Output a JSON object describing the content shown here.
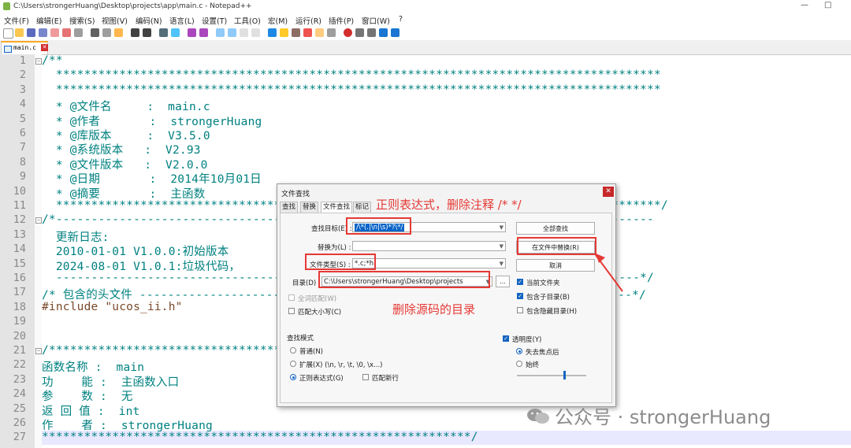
{
  "window": {
    "title": "C:\\Users\\strongerHuang\\Desktop\\projects\\app\\main.c - Notepad++",
    "controls": [
      "—",
      "□"
    ]
  },
  "menu": [
    "文件(F)",
    "编辑(E)",
    "搜索(S)",
    "视图(V)",
    "编码(N)",
    "语言(L)",
    "设置(T)",
    "工具(O)",
    "宏(M)",
    "运行(R)",
    "插件(P)",
    "窗口(W)",
    "?"
  ],
  "tab": {
    "label": "main.c",
    "close": "✕"
  },
  "editor": {
    "lines": [
      {
        "n": "1",
        "text": "/**",
        "style": "comment"
      },
      {
        "n": "2",
        "text": "  **************************************************************************************",
        "style": "comment"
      },
      {
        "n": "3",
        "text": "  **************************************************************************************",
        "style": "comment"
      },
      {
        "n": "4",
        "text": "  * @文件名     :  main.c",
        "style": "doc"
      },
      {
        "n": "5",
        "text": "  * @作者       :  strongerHuang",
        "style": "doc"
      },
      {
        "n": "6",
        "text": "  * @库版本     :  V3.5.0",
        "style": "doc"
      },
      {
        "n": "7",
        "text": "  * @系统版本   :  V2.93",
        "style": "doc"
      },
      {
        "n": "8",
        "text": "  * @文件版本   :  V2.0.0",
        "style": "doc"
      },
      {
        "n": "9",
        "text": "  * @日期       :  2014年10月01日",
        "style": "doc"
      },
      {
        "n": "10",
        "text": "  * @摘要       :  主函数",
        "style": "doc"
      },
      {
        "n": "11",
        "text": "  **************************************************************************************/",
        "style": "comment"
      },
      {
        "n": "12",
        "text": "/*-------------------------------------------------------------------------------------",
        "style": "comment"
      },
      {
        "n": "13",
        "text": "  更新日志:",
        "style": "comment"
      },
      {
        "n": "14",
        "text": "  2010-01-01 V1.0.0:初始版本",
        "style": "comment"
      },
      {
        "n": "15",
        "text": "  2024-08-01 V1.0.1:垃圾代码，",
        "style": "comment"
      },
      {
        "n": "16",
        "text": "  -----------------------------------------------------------------------------------*/",
        "style": "comment"
      },
      {
        "n": "17",
        "text": "/* 包含的头文件 ----------------------------------------------------------------------*/",
        "style": "comment"
      },
      {
        "n": "18",
        "text": "#include \"ucos_ii.h\"",
        "style": "pre"
      },
      {
        "n": "19",
        "text": "",
        "style": "plain"
      },
      {
        "n": "20",
        "text": "",
        "style": "plain"
      },
      {
        "n": "21",
        "text": "/************************************************",
        "style": "comment"
      },
      {
        "n": "22",
        "text": "函数名称 :  main",
        "style": "comment"
      },
      {
        "n": "23",
        "text": "功    能 :  主函数入口",
        "style": "comment"
      },
      {
        "n": "24",
        "text": "参    数 :  无",
        "style": "comment"
      },
      {
        "n": "25",
        "text": "返 回 值 :  int",
        "style": "comment"
      },
      {
        "n": "26",
        "text": "作    者 :  strongerHuang",
        "style": "comment"
      },
      {
        "n": "27",
        "text": "*************************************************************/",
        "style": "comment"
      }
    ]
  },
  "dialog": {
    "title": "文件查找",
    "close": "✕",
    "tabs": [
      "查找",
      "替换",
      "文件查找",
      "标记"
    ],
    "find_label": "查找目标(E) :",
    "find_value": "/\\*(.|\\n|\\s)*?\\*/",
    "replace_label": "替换为(L) :",
    "replace_value": "",
    "filter_label": "文件类型(S) :",
    "filter_value": "*.c;*h",
    "dir_label": "目录(D) :",
    "dir_value": "C:\\Users\\strongerHuang\\Desktop\\projects",
    "browse": "...",
    "btn_find_all": "全部查找",
    "btn_replace_in_files": "在文件中替换(R)",
    "btn_cancel": "取消",
    "chk_current_folder": "当前文件夹",
    "chk_subfolders": "包含子目录(B)",
    "chk_hidden": "包含隐藏目录(H)",
    "chk_whole_word": "全词匹配(W)",
    "chk_match_case": "匹配大小写(C)",
    "mode_title": "查找模式",
    "mode_normal": "普通(N)",
    "mode_extended": "扩展(X) (\\n, \\r, \\t, \\0, \\x...)",
    "mode_regex": "正则表达式(G)",
    "chk_dot_newline": "匹配新行",
    "transparency": "透明度(Y)",
    "trans_on_lose_focus": "失去焦点后",
    "trans_always": "始终"
  },
  "annotations": {
    "regex_note": "正则表达式，删除注释 /* */",
    "dir_note": "删除源码的目录"
  },
  "watermark": "公众号 · strongerHuang",
  "colors": {
    "annotation": "#e53935",
    "comment": "#008080"
  }
}
